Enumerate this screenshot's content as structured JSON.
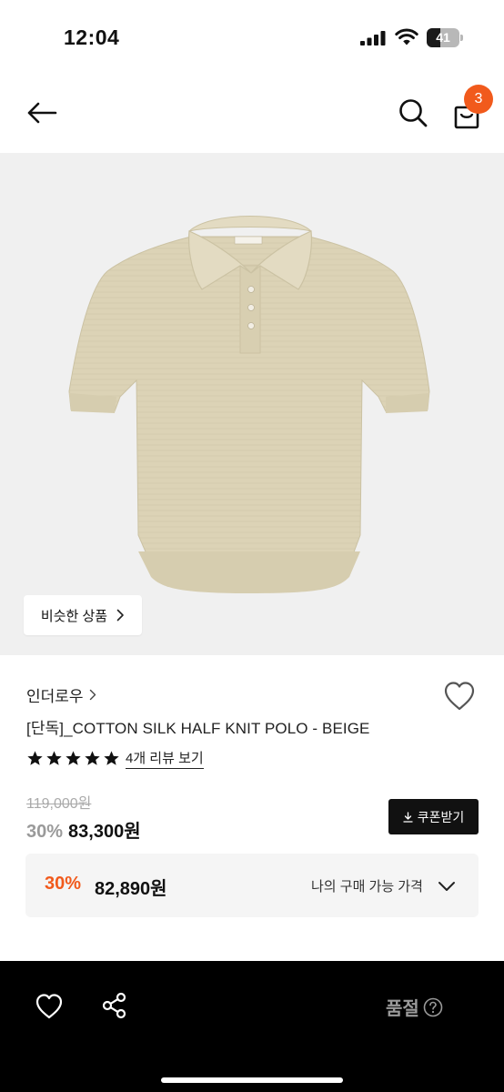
{
  "status_bar": {
    "time": "12:04",
    "battery": "41",
    "battery_level": 0.41
  },
  "header": {
    "cart_count": "3"
  },
  "image": {
    "similar_label": "비슷한 상품"
  },
  "product": {
    "brand": "인더로우",
    "title": "[단독]_COTTON SILK HALF KNIT POLO - BEIGE",
    "rating": 5,
    "review_link": "4개 리뷰 보기",
    "original_price": "119,000원",
    "discount_rate": "30%",
    "sale_price": "83,300원",
    "coupon_label": "쿠폰받기"
  },
  "best_price": {
    "rate": "30%",
    "price": "82,890원",
    "label": "나의 구매 가능 가격"
  },
  "bottom_bar": {
    "soldout_label": "품절"
  },
  "colors": {
    "accent": "#f15a1c",
    "product_bg": "#f0f0f0",
    "polo": "#dcd3b6"
  }
}
